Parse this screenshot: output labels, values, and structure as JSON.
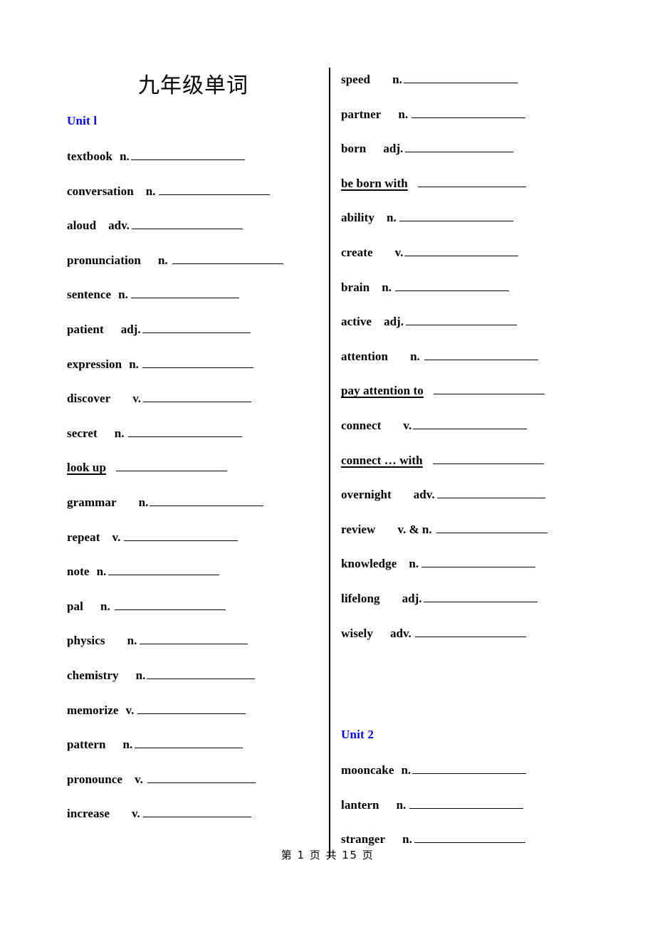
{
  "document": {
    "title": "九年级单词",
    "footer": "第 1 页 共 15 页"
  },
  "colors": {
    "unit_heading": "#0000FF",
    "text": "#000000",
    "page_background": "#FFFFFF",
    "rule": "#000000"
  },
  "left_column": {
    "unit_label": "Unit l",
    "entries": [
      {
        "word": "textbook",
        "pos": "n.",
        "is_phrase": false
      },
      {
        "word": "conversation",
        "pos": "n.",
        "is_phrase": false
      },
      {
        "word": "aloud",
        "pos": "adv.",
        "is_phrase": false
      },
      {
        "word": "pronunciation",
        "pos": "n.",
        "is_phrase": false
      },
      {
        "word": "sentence",
        "pos": "n.",
        "is_phrase": false
      },
      {
        "word": "patient",
        "pos": "adj.",
        "is_phrase": false
      },
      {
        "word": "expression",
        "pos": "n.",
        "is_phrase": false
      },
      {
        "word": "discover",
        "pos": "v.",
        "is_phrase": false
      },
      {
        "word": "secret",
        "pos": "n.",
        "is_phrase": false
      },
      {
        "word": "look up",
        "pos": "",
        "is_phrase": true
      },
      {
        "word": "grammar",
        "pos": "n.",
        "is_phrase": false
      },
      {
        "word": "repeat",
        "pos": "v.",
        "is_phrase": false
      },
      {
        "word": "note",
        "pos": "n.",
        "is_phrase": false
      },
      {
        "word": "pal",
        "pos": "n.",
        "is_phrase": false
      },
      {
        "word": "physics",
        "pos": "n.",
        "is_phrase": false
      },
      {
        "word": "chemistry",
        "pos": "n.",
        "is_phrase": false
      },
      {
        "word": "memorize",
        "pos": "v.",
        "is_phrase": false
      },
      {
        "word": "pattern",
        "pos": "n.",
        "is_phrase": false
      },
      {
        "word": "pronounce",
        "pos": "v.",
        "is_phrase": false
      },
      {
        "word": "increase",
        "pos": "v.",
        "is_phrase": false
      }
    ]
  },
  "right_column": {
    "entries_unit1": [
      {
        "word": "speed",
        "pos": "n.",
        "is_phrase": false
      },
      {
        "word": "partner",
        "pos": "n.",
        "is_phrase": false
      },
      {
        "word": "born",
        "pos": "adj.",
        "is_phrase": false
      },
      {
        "word": "be born with",
        "pos": "",
        "is_phrase": true
      },
      {
        "word": "ability",
        "pos": "n.",
        "is_phrase": false
      },
      {
        "word": "create",
        "pos": "v.",
        "is_phrase": false
      },
      {
        "word": "brain",
        "pos": "n.",
        "is_phrase": false
      },
      {
        "word": "active",
        "pos": "adj.",
        "is_phrase": false
      },
      {
        "word": "attention",
        "pos": "n.",
        "is_phrase": false
      },
      {
        "word": "pay attention to",
        "pos": "",
        "is_phrase": true
      },
      {
        "word": "connect",
        "pos": "v.",
        "is_phrase": false
      },
      {
        "word": "connect … with",
        "pos": "",
        "is_phrase": true
      },
      {
        "word": "overnight",
        "pos": "adv.",
        "is_phrase": false
      },
      {
        "word": "review",
        "pos": "v. & n.",
        "is_phrase": false
      },
      {
        "word": "knowledge",
        "pos": "n.",
        "is_phrase": false
      },
      {
        "word": "lifelong",
        "pos": "adj.",
        "is_phrase": false
      },
      {
        "word": "wisely",
        "pos": "adv.",
        "is_phrase": false
      }
    ],
    "unit_label": "Unit 2",
    "entries_unit2": [
      {
        "word": "mooncake",
        "pos": "n.",
        "is_phrase": false
      },
      {
        "word": "lantern",
        "pos": "n.",
        "is_phrase": false
      },
      {
        "word": "stranger",
        "pos": "n.",
        "is_phrase": false
      }
    ]
  }
}
